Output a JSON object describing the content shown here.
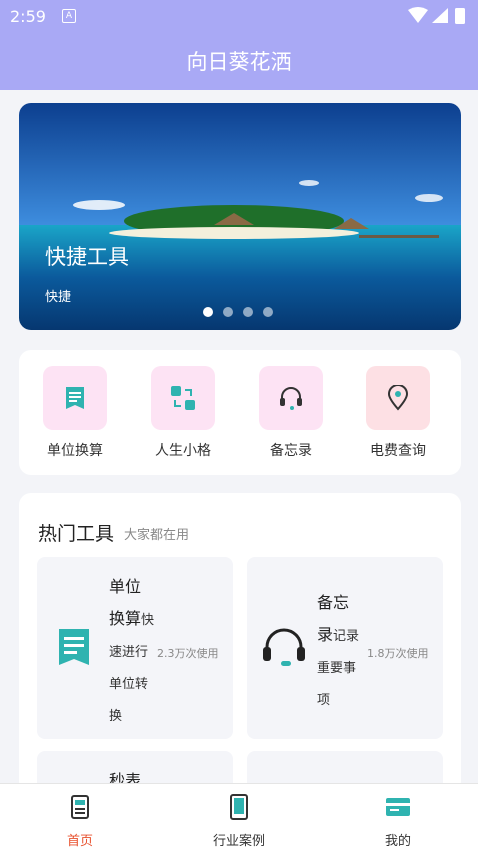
{
  "status": {
    "time": "2:59"
  },
  "header": {
    "title": "向日葵花洒"
  },
  "banner": {
    "title": "快捷工具",
    "subtitle": "快捷",
    "slides": 4,
    "active_slide": 0
  },
  "quick_tools": [
    {
      "label": "单位换算",
      "icon": "document-icon",
      "bg": "#fde3f4"
    },
    {
      "label": "人生小格",
      "icon": "swap-icon",
      "bg": "#fde3f4"
    },
    {
      "label": "备忘录",
      "icon": "headset-icon",
      "bg": "#fde3f4"
    },
    {
      "label": "电费查询",
      "icon": "location-pin-icon",
      "bg": "#fde0e4"
    }
  ],
  "hot": {
    "title": "热门工具",
    "subtitle": "大家都在用",
    "cards": [
      {
        "name_l1": "单位",
        "name_l2": "换算",
        "desc_l2": "快",
        "desc_l3": "速进行",
        "desc_l4": "单位转",
        "desc_l5": "换",
        "uses": "2.3万次使用",
        "icon": "document-icon"
      },
      {
        "name_l1": "备忘",
        "name_l2": "录",
        "desc_l2": "记录",
        "desc_l3": "重要事",
        "desc_l4": "项",
        "uses": "1.8万次使用",
        "icon": "headset-icon"
      },
      {
        "name_l1": "秒表"
      }
    ]
  },
  "tabs": [
    {
      "label": "首页",
      "icon": "home-doc-icon",
      "active": true
    },
    {
      "label": "行业案例",
      "icon": "tablet-icon",
      "active": false
    },
    {
      "label": "我的",
      "icon": "card-icon",
      "active": false
    }
  ],
  "colors": {
    "accent": "#a9a9f5",
    "teal": "#2fb3b0",
    "active_tab": "#e8522f"
  }
}
